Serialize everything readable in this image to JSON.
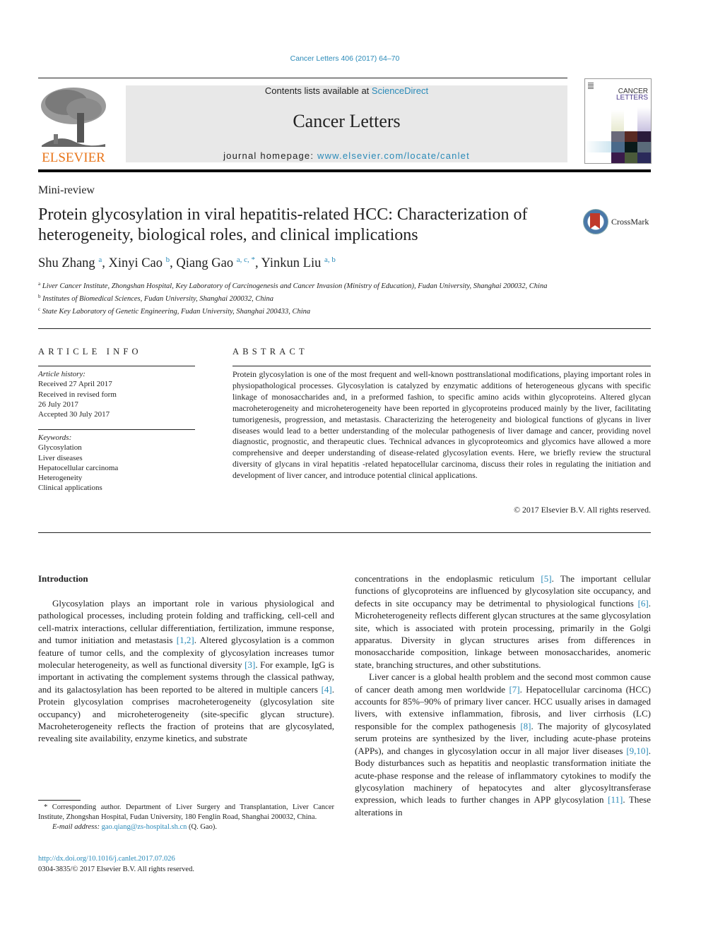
{
  "header": {
    "journal_ref": "Cancer Letters 406 (2017) 64–70",
    "contents_prefix": "Contents lists available at ",
    "contents_link": "ScienceDirect",
    "journal_name": "Cancer Letters",
    "homepage_prefix": "journal homepage: ",
    "homepage_link": "www.elsevier.com/locate/canlet",
    "publisher_logo_text": "ELSEVIER",
    "cover_title_line1": "CANCER",
    "cover_title_line2": "LETTERS"
  },
  "article": {
    "type": "Mini-review",
    "title": "Protein glycosylation in viral hepatitis-related HCC: Characterization of heterogeneity, biological roles, and clinical implications",
    "crossmark_label": "CrossMark",
    "authors": [
      {
        "name": "Shu Zhang",
        "sup": "a"
      },
      {
        "name": "Xinyi Cao",
        "sup": "b"
      },
      {
        "name": "Qiang Gao",
        "sup": "a, c, *"
      },
      {
        "name": "Yinkun Liu",
        "sup": "a, b"
      }
    ],
    "affiliations": [
      {
        "key": "a",
        "text": "Liver Cancer Institute, Zhongshan Hospital, Key Laboratory of Carcinogenesis and Cancer Invasion (Ministry of Education), Fudan University, Shanghai 200032, China"
      },
      {
        "key": "b",
        "text": "Institutes of Biomedical Sciences, Fudan University, Shanghai 200032, China"
      },
      {
        "key": "c",
        "text": "State Key Laboratory of Genetic Engineering, Fudan University, Shanghai 200433, China"
      }
    ]
  },
  "article_info": {
    "heading": "ARTICLE INFO",
    "history_label": "Article history:",
    "history": [
      "Received 27 April 2017",
      "Received in revised form",
      "26 July 2017",
      "Accepted 30 July 2017"
    ],
    "keywords_label": "Keywords:",
    "keywords": [
      "Glycosylation",
      "Liver diseases",
      "Hepatocellular carcinoma",
      "Heterogeneity",
      "Clinical applications"
    ]
  },
  "abstract": {
    "heading": "ABSTRACT",
    "text": "Protein glycosylation is one of the most frequent and well-known posttranslational modifications, playing important roles in physiopathological processes. Glycosylation is catalyzed by enzymatic additions of heterogeneous glycans with specific linkage of monosaccharides and, in a preformed fashion, to specific amino acids within glycoproteins. Altered glycan macroheterogeneity and microheterogeneity have been reported in glycoproteins produced mainly by the liver, facilitating tumorigenesis, progression, and metastasis. Characterizing the heterogeneity and biological functions of glycans in liver diseases would lead to a better understanding of the molecular pathogenesis of liver damage and cancer, providing novel diagnostic, prognostic, and therapeutic clues. Technical advances in glycoproteomics and glycomics have allowed a more comprehensive and deeper understanding of disease-related glycosylation events. Here, we briefly review the structural diversity of glycans in viral hepatitis -related hepatocellular carcinoma, discuss their roles in regulating the initiation and development of liver cancer, and introduce potential clinical applications.",
    "copyright": "© 2017 Elsevier B.V. All rights reserved."
  },
  "body": {
    "intro_heading": "Introduction",
    "left_para": [
      {
        "t": "Glycosylation plays an important role in various physiological and pathological processes, including protein folding and trafficking, cell-cell and cell-matrix interactions, cellular differentiation, fertilization, immune response, and tumor initiation and metastasis "
      },
      {
        "ref": "[1,2]"
      },
      {
        "t": ". Altered glycosylation is a common feature of tumor cells, and the complexity of glycosylation increases tumor molecular heterogeneity, as well as functional diversity "
      },
      {
        "ref": "[3]"
      },
      {
        "t": ". For example, IgG is important in activating the complement systems through the classical pathway, and its galactosylation has been reported to be altered in multiple cancers "
      },
      {
        "ref": "[4]"
      },
      {
        "t": ". Protein glycosylation comprises macroheterogeneity (glycosylation site occupancy) and microheterogeneity (site-specific glycan structure). Macroheterogeneity reflects the fraction of proteins that are glycosylated, revealing site availability, enzyme kinetics, and substrate"
      }
    ],
    "right_para1": [
      {
        "t": "concentrations in the endoplasmic reticulum "
      },
      {
        "ref": "[5]"
      },
      {
        "t": ". The important cellular functions of glycoproteins are influenced by glycosylation site occupancy, and defects in site occupancy may be detrimental to physiological functions "
      },
      {
        "ref": "[6]"
      },
      {
        "t": ". Microheterogeneity reflects different glycan structures at the same glycosylation site, which is associated with protein processing, primarily in the Golgi apparatus. Diversity in glycan structures arises from differences in monosaccharide composition, linkage between monosaccharides, anomeric state, branching structures, and other substitutions."
      }
    ],
    "right_para2": [
      {
        "t": "Liver cancer is a global health problem and the second most common cause of cancer death among men worldwide "
      },
      {
        "ref": "[7]"
      },
      {
        "t": ". Hepatocellular carcinoma (HCC) accounts for 85%–90% of primary liver cancer. HCC usually arises in damaged livers, with extensive inflammation, fibrosis, and liver cirrhosis (LC) responsible for the complex pathogenesis "
      },
      {
        "ref": "[8]"
      },
      {
        "t": ". The majority of glycosylated serum proteins are synthesized by the liver, including acute-phase proteins (APPs), and changes in glycosylation occur in all major liver diseases "
      },
      {
        "ref": "[9,10]"
      },
      {
        "t": ". Body disturbances such as hepatitis and neoplastic transformation initiate the acute-phase response and the release of inflammatory cytokines to modify the glycosylation machinery of hepatocytes and alter glycosyltransferase expression, which leads to further changes in APP glycosylation "
      },
      {
        "ref": "[11]"
      },
      {
        "t": ". These alterations in"
      }
    ]
  },
  "footnote": {
    "corresponding": "* Corresponding author. Department of Liver Surgery and Transplantation, Liver Cancer Institute, Zhongshan Hospital, Fudan University, 180 Fenglin Road, Shanghai 200032, China.",
    "email_label": "E-mail address: ",
    "email": "gao.qiang@zs-hospital.sh.cn",
    "email_suffix": " (Q. Gao).",
    "doi": "http://dx.doi.org/10.1016/j.canlet.2017.07.026",
    "issn": "0304-3835/© 2017 Elsevier B.V. All rights reserved."
  }
}
